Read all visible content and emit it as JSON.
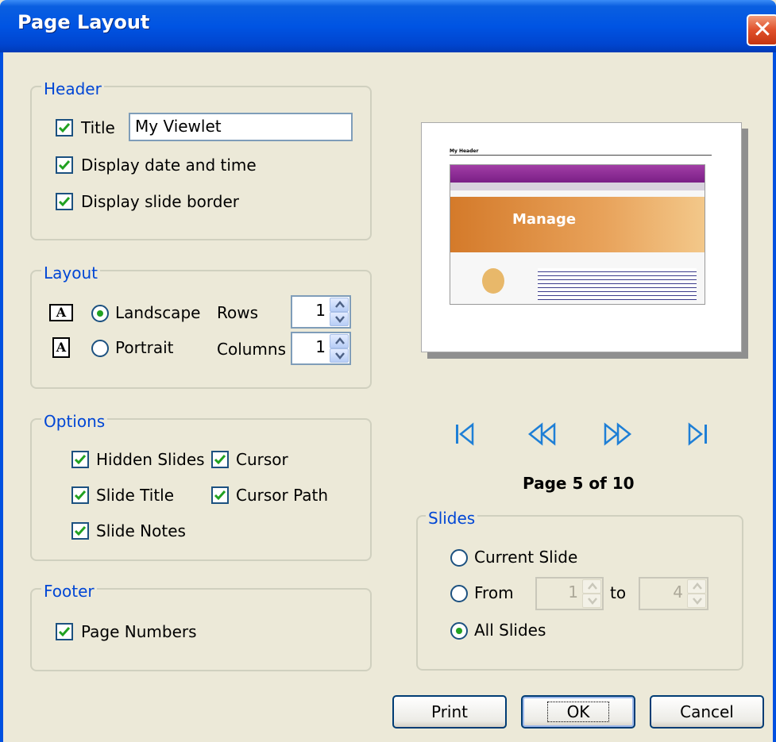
{
  "window": {
    "title": "Page Layout"
  },
  "header": {
    "legend": "Header",
    "title_label": "Title",
    "title_value": "My Viewlet",
    "display_date_label": "Display date and time",
    "display_border_label": "Display slide border",
    "title_checked": true,
    "date_checked": true,
    "border_checked": true
  },
  "layout": {
    "legend": "Layout",
    "landscape_label": "Landscape",
    "portrait_label": "Portrait",
    "selected": "Landscape",
    "rows_label": "Rows",
    "rows_value": "1",
    "columns_label": "Columns",
    "columns_value": "1"
  },
  "options": {
    "legend": "Options",
    "hidden_slides": "Hidden Slides",
    "cursor": "Cursor",
    "slide_title": "Slide Title",
    "cursor_path": "Cursor Path",
    "slide_notes": "Slide Notes"
  },
  "footer": {
    "legend": "Footer",
    "page_numbers": "Page Numbers"
  },
  "preview": {
    "header_text": "My Header",
    "banner_text": "Manage"
  },
  "nav": {
    "page_text": "Page 5 of 10"
  },
  "slides": {
    "legend": "Slides",
    "current_slide": "Current Slide",
    "from_label": "From",
    "from_value": "1",
    "to_label": "to",
    "to_value": "4",
    "all_slides": "All Slides",
    "selected": "All Slides"
  },
  "buttons": {
    "print": "Print",
    "ok": "OK",
    "cancel": "Cancel"
  },
  "colors": {
    "titlebar": "#0054e3",
    "dialog_bg": "#ece9d8",
    "legend_text": "#0046d5",
    "check_green": "#21a121",
    "nav_icon": "#1e7fd6"
  }
}
